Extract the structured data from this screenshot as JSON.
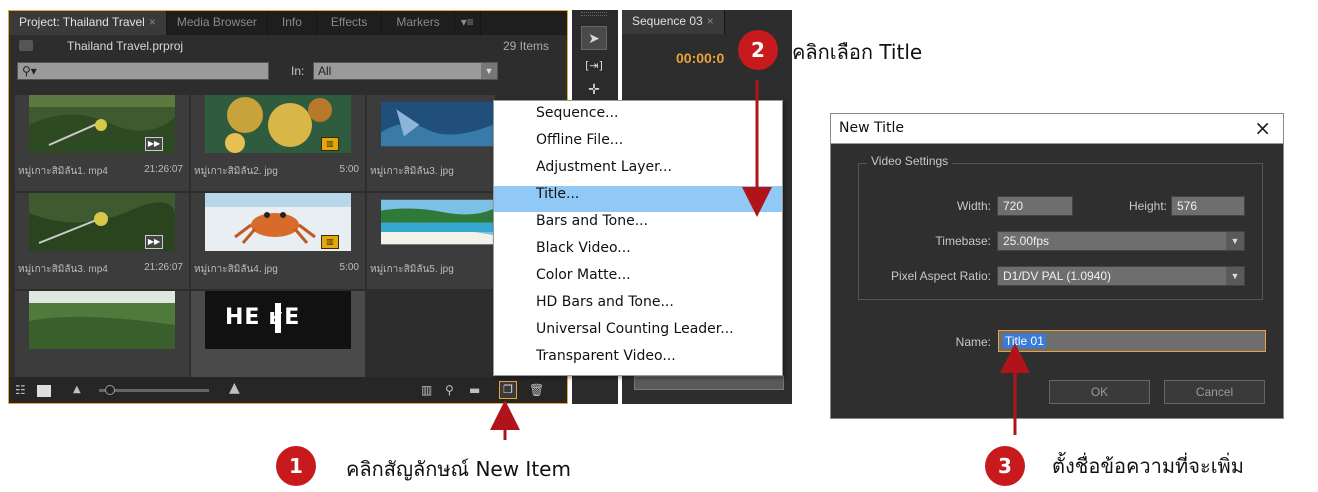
{
  "project_panel": {
    "tabs": [
      {
        "label": "Project: Thailand Travel",
        "close": "×"
      },
      {
        "label": "Media Browser"
      },
      {
        "label": "Info"
      },
      {
        "label": "Effects"
      },
      {
        "label": "Markers"
      }
    ],
    "menu_glyph": "▾≡",
    "project_file": "Thailand Travel.prproj",
    "item_count": "29 Items",
    "search_placeholder": "",
    "in_label": "In:",
    "in_value": "All",
    "thumbnails": [
      {
        "name": "หมู่เกาะสิมิลัน1. mp4",
        "duration": "21:26:07",
        "type": "video"
      },
      {
        "name": "หมู่เกาะสิมิลัน2. jpg",
        "duration": "5:00",
        "type": "image"
      },
      {
        "name": "หมู่เกาะสิมิลัน3. jpg",
        "duration": "",
        "type": "image"
      },
      {
        "name": "หมู่เกาะสิมิลัน3. mp4",
        "duration": "21:26:07",
        "type": "video"
      },
      {
        "name": "หมู่เกาะสิมิลัน4. jpg",
        "duration": "5:00",
        "type": "image"
      },
      {
        "name": "หมู่เกาะสิมิลัน5. jpg",
        "duration": "",
        "type": "image"
      },
      {
        "name": "",
        "duration": "",
        "type": "video"
      },
      {
        "name": "",
        "duration": "",
        "type": "title"
      }
    ],
    "title_thumb_text": "HE ʁE"
  },
  "sequence_panel": {
    "tab": "Sequence 03",
    "close": "×",
    "timecode": "00:00:0"
  },
  "context_menu": {
    "items": [
      "Sequence...",
      "Offline File...",
      "Adjustment Layer...",
      "Title...",
      "Bars and Tone...",
      "Black Video...",
      "Color Matte...",
      "HD Bars and Tone...",
      "Universal Counting Leader...",
      "Transparent Video..."
    ],
    "highlighted": "Title..."
  },
  "dialog": {
    "title": "New Title",
    "close": "×",
    "group_title": "Video Settings",
    "width_label": "Width:",
    "width_value": "720",
    "height_label": "Height:",
    "height_value": "576",
    "timebase_label": "Timebase:",
    "timebase_value": "25.00fps",
    "par_label": "Pixel Aspect Ratio:",
    "par_value": "D1/DV PAL (1.0940)",
    "name_label": "Name:",
    "name_value": "Title 01",
    "ok_label": "OK",
    "cancel_label": "Cancel"
  },
  "annotations": [
    {
      "number": "1",
      "caption": "คลิกสัญลักษณ์ New Item"
    },
    {
      "number": "2",
      "caption": "คลิกเลือก Title"
    },
    {
      "number": "3",
      "caption": "ตั้งชื่อข้อความที่จะเพิ่ม"
    }
  ],
  "colors": {
    "accent_orange": "#e8a33c",
    "annotation_red": "#c8191c",
    "menu_highlight": "#90c8f6"
  }
}
